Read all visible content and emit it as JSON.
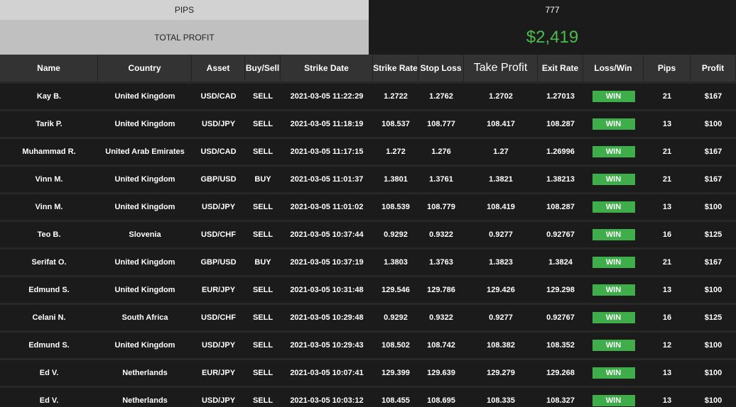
{
  "summary": {
    "pips_label": "PIPS",
    "pips_value": "777",
    "profit_label": "TOTAL PROFIT",
    "profit_value": "$2,419",
    "profit_color": "#4cbb4c"
  },
  "table": {
    "headers": [
      "Name",
      "Country",
      "Asset",
      "Buy/Sell",
      "Strike Date",
      "Strike Rate",
      "Stop Loss",
      "Take Profit",
      "Exit Rate",
      "Loss/Win",
      "Pips",
      "Profit"
    ],
    "rows": [
      [
        "Kay B.",
        "United Kingdom",
        "USD/CAD",
        "SELL",
        "2021-03-05 11:22:29",
        "1.2722",
        "1.2762",
        "1.2702",
        "1.27013",
        "WIN",
        "21",
        "$167"
      ],
      [
        "Tarik P.",
        "United Kingdom",
        "USD/JPY",
        "SELL",
        "2021-03-05 11:18:19",
        "108.537",
        "108.777",
        "108.417",
        "108.287",
        "WIN",
        "13",
        "$100"
      ],
      [
        "Muhammad R.",
        "United Arab Emirates",
        "USD/CAD",
        "SELL",
        "2021-03-05 11:17:15",
        "1.272",
        "1.276",
        "1.27",
        "1.26996",
        "WIN",
        "21",
        "$167"
      ],
      [
        "Vinn M.",
        "United Kingdom",
        "GBP/USD",
        "BUY",
        "2021-03-05 11:01:37",
        "1.3801",
        "1.3761",
        "1.3821",
        "1.38213",
        "WIN",
        "21",
        "$167"
      ],
      [
        "Vinn M.",
        "United Kingdom",
        "USD/JPY",
        "SELL",
        "2021-03-05 11:01:02",
        "108.539",
        "108.779",
        "108.419",
        "108.287",
        "WIN",
        "13",
        "$100"
      ],
      [
        "Teo B.",
        "Slovenia",
        "USD/CHF",
        "SELL",
        "2021-03-05 10:37:44",
        "0.9292",
        "0.9322",
        "0.9277",
        "0.92767",
        "WIN",
        "16",
        "$125"
      ],
      [
        "Serifat O.",
        "United Kingdom",
        "GBP/USD",
        "BUY",
        "2021-03-05 10:37:19",
        "1.3803",
        "1.3763",
        "1.3823",
        "1.3824",
        "WIN",
        "21",
        "$167"
      ],
      [
        "Edmund S.",
        "United Kingdom",
        "EUR/JPY",
        "SELL",
        "2021-03-05 10:31:48",
        "129.546",
        "129.786",
        "129.426",
        "129.298",
        "WIN",
        "13",
        "$100"
      ],
      [
        "Celani N.",
        "South Africa",
        "USD/CHF",
        "SELL",
        "2021-03-05 10:29:48",
        "0.9292",
        "0.9322",
        "0.9277",
        "0.92767",
        "WIN",
        "16",
        "$125"
      ],
      [
        "Edmund S.",
        "United Kingdom",
        "USD/JPY",
        "SELL",
        "2021-03-05 10:29:43",
        "108.502",
        "108.742",
        "108.382",
        "108.352",
        "WIN",
        "12",
        "$100"
      ],
      [
        "Ed V.",
        "Netherlands",
        "EUR/JPY",
        "SELL",
        "2021-03-05 10:07:41",
        "129.399",
        "129.639",
        "129.279",
        "129.268",
        "WIN",
        "13",
        "$100"
      ],
      [
        "Ed V.",
        "Netherlands",
        "USD/JPY",
        "SELL",
        "2021-03-05 10:03:12",
        "108.455",
        "108.695",
        "108.335",
        "108.327",
        "WIN",
        "13",
        "$100"
      ]
    ]
  },
  "colors": {
    "win_badge": "#3fae4a",
    "header_bg": "#333333",
    "row_bg": "#1b1b1b"
  }
}
